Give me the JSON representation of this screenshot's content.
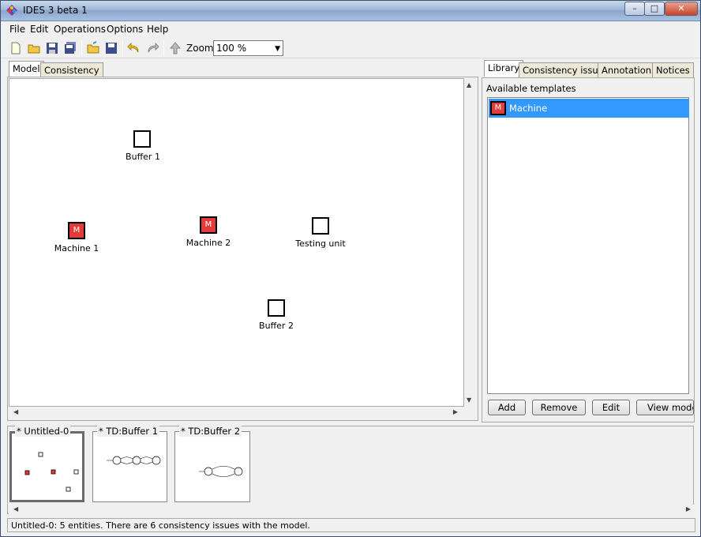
{
  "window": {
    "title": "IDES 3 beta 1",
    "controls": {
      "minimize": "–",
      "maximize": "□",
      "close": "✕"
    }
  },
  "menubar": [
    "File",
    "Edit",
    "Operations",
    "Options",
    "Help"
  ],
  "toolbar": {
    "icons": [
      "new-file-icon",
      "open-folder-icon",
      "save-icon",
      "save-all-icon",
      "open-workspace-icon",
      "save-workspace-icon",
      "undo-icon",
      "redo-icon",
      "up-level-icon"
    ],
    "zoom_label": "Zoom:",
    "zoom_value": "100 %"
  },
  "left_tabs": [
    "Model",
    "Consistency"
  ],
  "model": {
    "nodes": [
      {
        "label": "Buffer 1",
        "kind": "buffer",
        "icon_text": ""
      },
      {
        "label": "Machine 1",
        "kind": "machine",
        "icon_text": "M"
      },
      {
        "label": "Machine 2",
        "kind": "machine",
        "icon_text": "M"
      },
      {
        "label": "Testing unit",
        "kind": "buffer",
        "icon_text": ""
      },
      {
        "label": "Buffer 2",
        "kind": "buffer",
        "icon_text": ""
      }
    ]
  },
  "right_tabs": [
    "Library",
    "Consistency issues",
    "Annotations",
    "Notices"
  ],
  "library": {
    "heading": "Available templates",
    "items": [
      {
        "icon_text": "M",
        "label": "Machine"
      }
    ],
    "buttons": [
      "Add",
      "Remove",
      "Edit",
      "View model"
    ]
  },
  "thumbnails": [
    "* Untitled-0",
    "* TD:Buffer 1",
    "* TD:Buffer 2"
  ],
  "status": "Untitled-0:  5 entities. There are 6 consistency issues with the model.",
  "colors": {
    "machine": "#e53a3a",
    "selection": "#3399ff"
  }
}
